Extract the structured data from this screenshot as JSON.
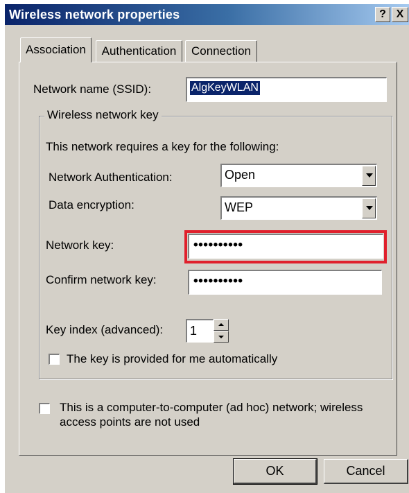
{
  "window": {
    "title": "Wireless network properties",
    "help_glyph": "?",
    "close_glyph": "X"
  },
  "tabs": [
    {
      "label": "Association",
      "selected": true
    },
    {
      "label": "Authentication",
      "selected": false
    },
    {
      "label": "Connection",
      "selected": false
    }
  ],
  "association": {
    "ssid_label": "Network name (SSID):",
    "ssid_value": "AlgKeyWLAN",
    "group_title": "Wireless network key",
    "requires_text": "This network requires a key for the following:",
    "auth_label": "Network Authentication:",
    "auth_value": "Open",
    "encryption_label": "Data encryption:",
    "encryption_value": "WEP",
    "network_key_label": "Network key:",
    "network_key_value": "••••••••••",
    "confirm_key_label": "Confirm network key:",
    "confirm_key_value": "••••••••••",
    "key_index_label": "Key index (advanced):",
    "key_index_value": "1",
    "auto_key_label": "The key is provided for me automatically",
    "auto_key_checked": false,
    "adhoc_label_line1": "This is a computer-to-computer (ad hoc) network; wireless",
    "adhoc_label_line2": "access points are not used",
    "adhoc_checked": false
  },
  "buttons": {
    "ok": "OK",
    "cancel": "Cancel"
  },
  "colors": {
    "dialog_bg": "#d4d0c8",
    "title_start": "#0a246a",
    "title_end": "#a6caf0",
    "highlight": "#e0202c"
  }
}
